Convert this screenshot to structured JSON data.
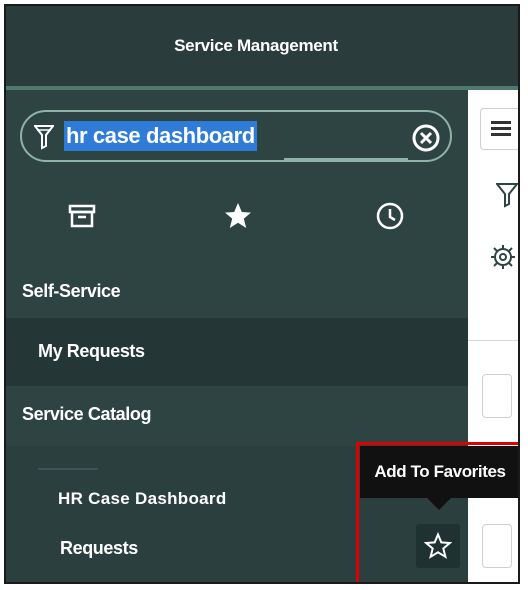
{
  "app": {
    "title": "Service Management"
  },
  "search": {
    "value": "hr case dashboard"
  },
  "icons": {
    "filter": "filter-icon",
    "clear": "clear-icon",
    "archive": "archive-icon",
    "favorites": "star-icon",
    "history": "clock-icon",
    "menu": "menu-icon",
    "settings": "gear-icon"
  },
  "nav": {
    "sections": [
      {
        "label": "Self-Service"
      },
      {
        "label": "My Requests"
      },
      {
        "label": "Service Catalog"
      },
      {
        "label": "HR Case Dashboard"
      },
      {
        "label": "Requests"
      }
    ]
  },
  "tooltip": {
    "text": "Add To Favorites"
  },
  "colors": {
    "banner": "#2a3c3b",
    "nav_background": "#2e4443",
    "search_highlight": "#2f7bd8",
    "accent_border": "#8fb3a6",
    "annotation": "#e00000"
  }
}
